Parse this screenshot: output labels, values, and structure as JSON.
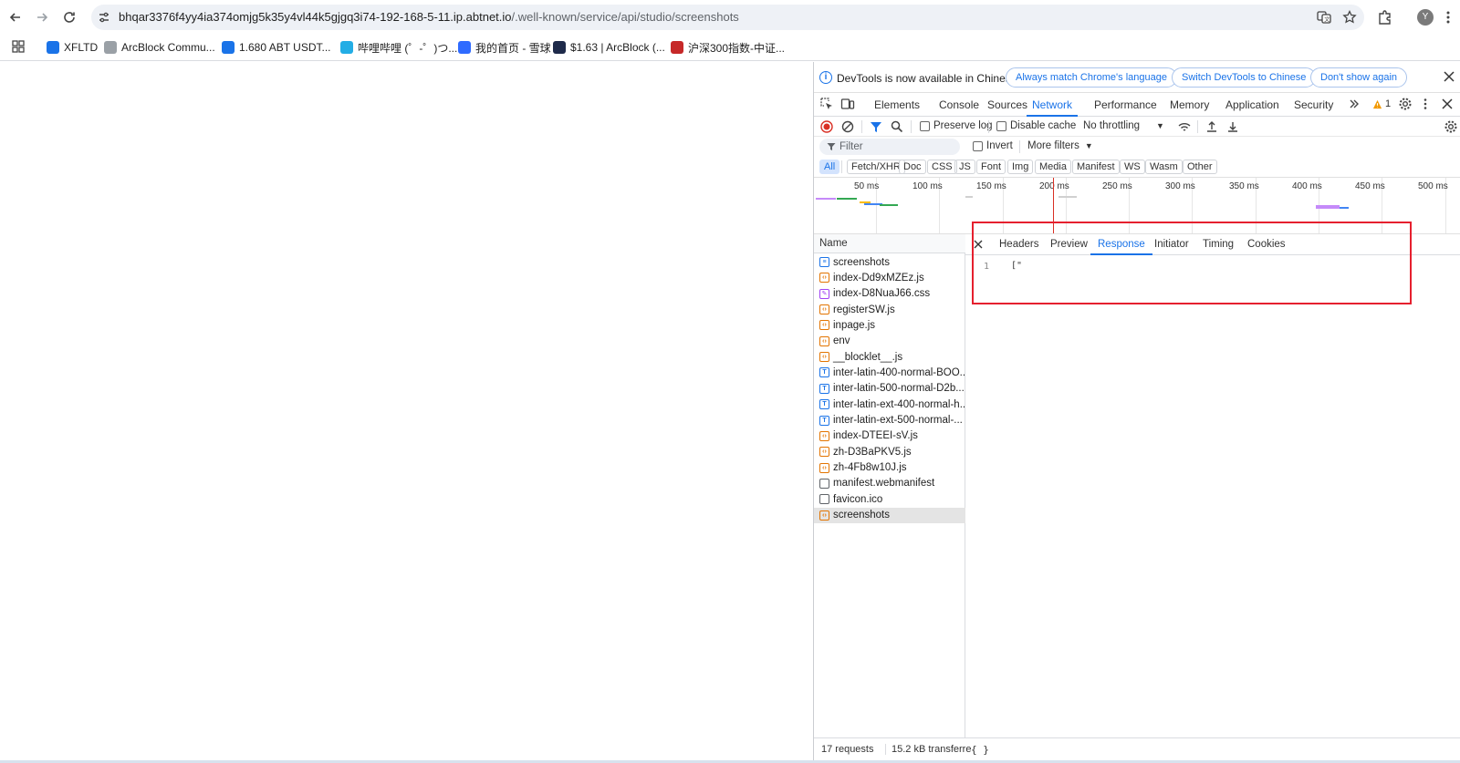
{
  "browser": {
    "url_host": "bhqar3376f4yy4ia374omjg5k35y4vl44k5gjgq3i74-192-168-5-11.ip.abtnet.io",
    "url_path": "/.well-known/service/api/studio/screenshots",
    "avatar_initial": "Y",
    "bookmarks": [
      {
        "label": "XFLTD",
        "color": "#1a73e8"
      },
      {
        "label": "ArcBlock Commu...",
        "color": "#9aa0a6"
      },
      {
        "label": "1.680 ABT USDT...",
        "color": "#1a73e8"
      },
      {
        "label": "哔哩哔哩 (゜-゜)つ...",
        "color": "#23ade5"
      },
      {
        "label": "我的首页 - 雪球",
        "color": "#2f6bff"
      },
      {
        "label": "$1.63 | ArcBlock (...",
        "color": "#1e2a4a"
      },
      {
        "label": "沪深300指数-中证...",
        "color": "#c62828"
      }
    ]
  },
  "devtools": {
    "infobar": {
      "message": "DevTools is now available in Chinese!",
      "btn_match": "Always match Chrome's language",
      "btn_switch": "Switch DevTools to Chinese",
      "btn_dismiss": "Don't show again"
    },
    "tabs": [
      "Elements",
      "Console",
      "Sources",
      "Network",
      "Performance",
      "Memory",
      "Application",
      "Security"
    ],
    "active_tab": "Network",
    "warning_count": "1",
    "network_toolbar": {
      "preserve_log": "Preserve log",
      "disable_cache": "Disable cache",
      "throttling": "No throttling"
    },
    "filter": {
      "placeholder": "Filter",
      "invert": "Invert",
      "more_filters": "More filters"
    },
    "type_filters": [
      "All",
      "Fetch/XHR",
      "Doc",
      "CSS",
      "JS",
      "Font",
      "Img",
      "Media",
      "Manifest",
      "WS",
      "Wasm",
      "Other"
    ],
    "timeline_labels": [
      "50 ms",
      "100 ms",
      "150 ms",
      "200 ms",
      "250 ms",
      "300 ms",
      "350 ms",
      "400 ms",
      "450 ms",
      "500 ms"
    ],
    "name_header": "Name",
    "requests": [
      {
        "name": "screenshots",
        "type": "doc"
      },
      {
        "name": "index-Dd9xMZEz.js",
        "type": "script"
      },
      {
        "name": "index-D8NuaJ66.css",
        "type": "css"
      },
      {
        "name": "registerSW.js",
        "type": "script"
      },
      {
        "name": "inpage.js",
        "type": "script"
      },
      {
        "name": "env",
        "type": "script"
      },
      {
        "name": "__blocklet__.js",
        "type": "script"
      },
      {
        "name": "inter-latin-400-normal-BOO...",
        "type": "font"
      },
      {
        "name": "inter-latin-500-normal-D2b...",
        "type": "font"
      },
      {
        "name": "inter-latin-ext-400-normal-h...",
        "type": "font"
      },
      {
        "name": "inter-latin-ext-500-normal-...",
        "type": "font"
      },
      {
        "name": "index-DTEEI-sV.js",
        "type": "script"
      },
      {
        "name": "zh-D3BaPKV5.js",
        "type": "script"
      },
      {
        "name": "zh-4Fb8w10J.js",
        "type": "script"
      },
      {
        "name": "manifest.webmanifest",
        "type": "plain"
      },
      {
        "name": "favicon.ico",
        "type": "plain"
      },
      {
        "name": "screenshots",
        "type": "script",
        "selected": true
      }
    ],
    "detail_tabs": [
      "Headers",
      "Preview",
      "Response",
      "Initiator",
      "Timing",
      "Cookies"
    ],
    "active_detail_tab": "Response",
    "response": {
      "line_number": "1",
      "content": "[\""
    },
    "status": {
      "requests": "17 requests",
      "transferred": "15.2 kB transferre",
      "pretty_print": "{ }"
    }
  }
}
